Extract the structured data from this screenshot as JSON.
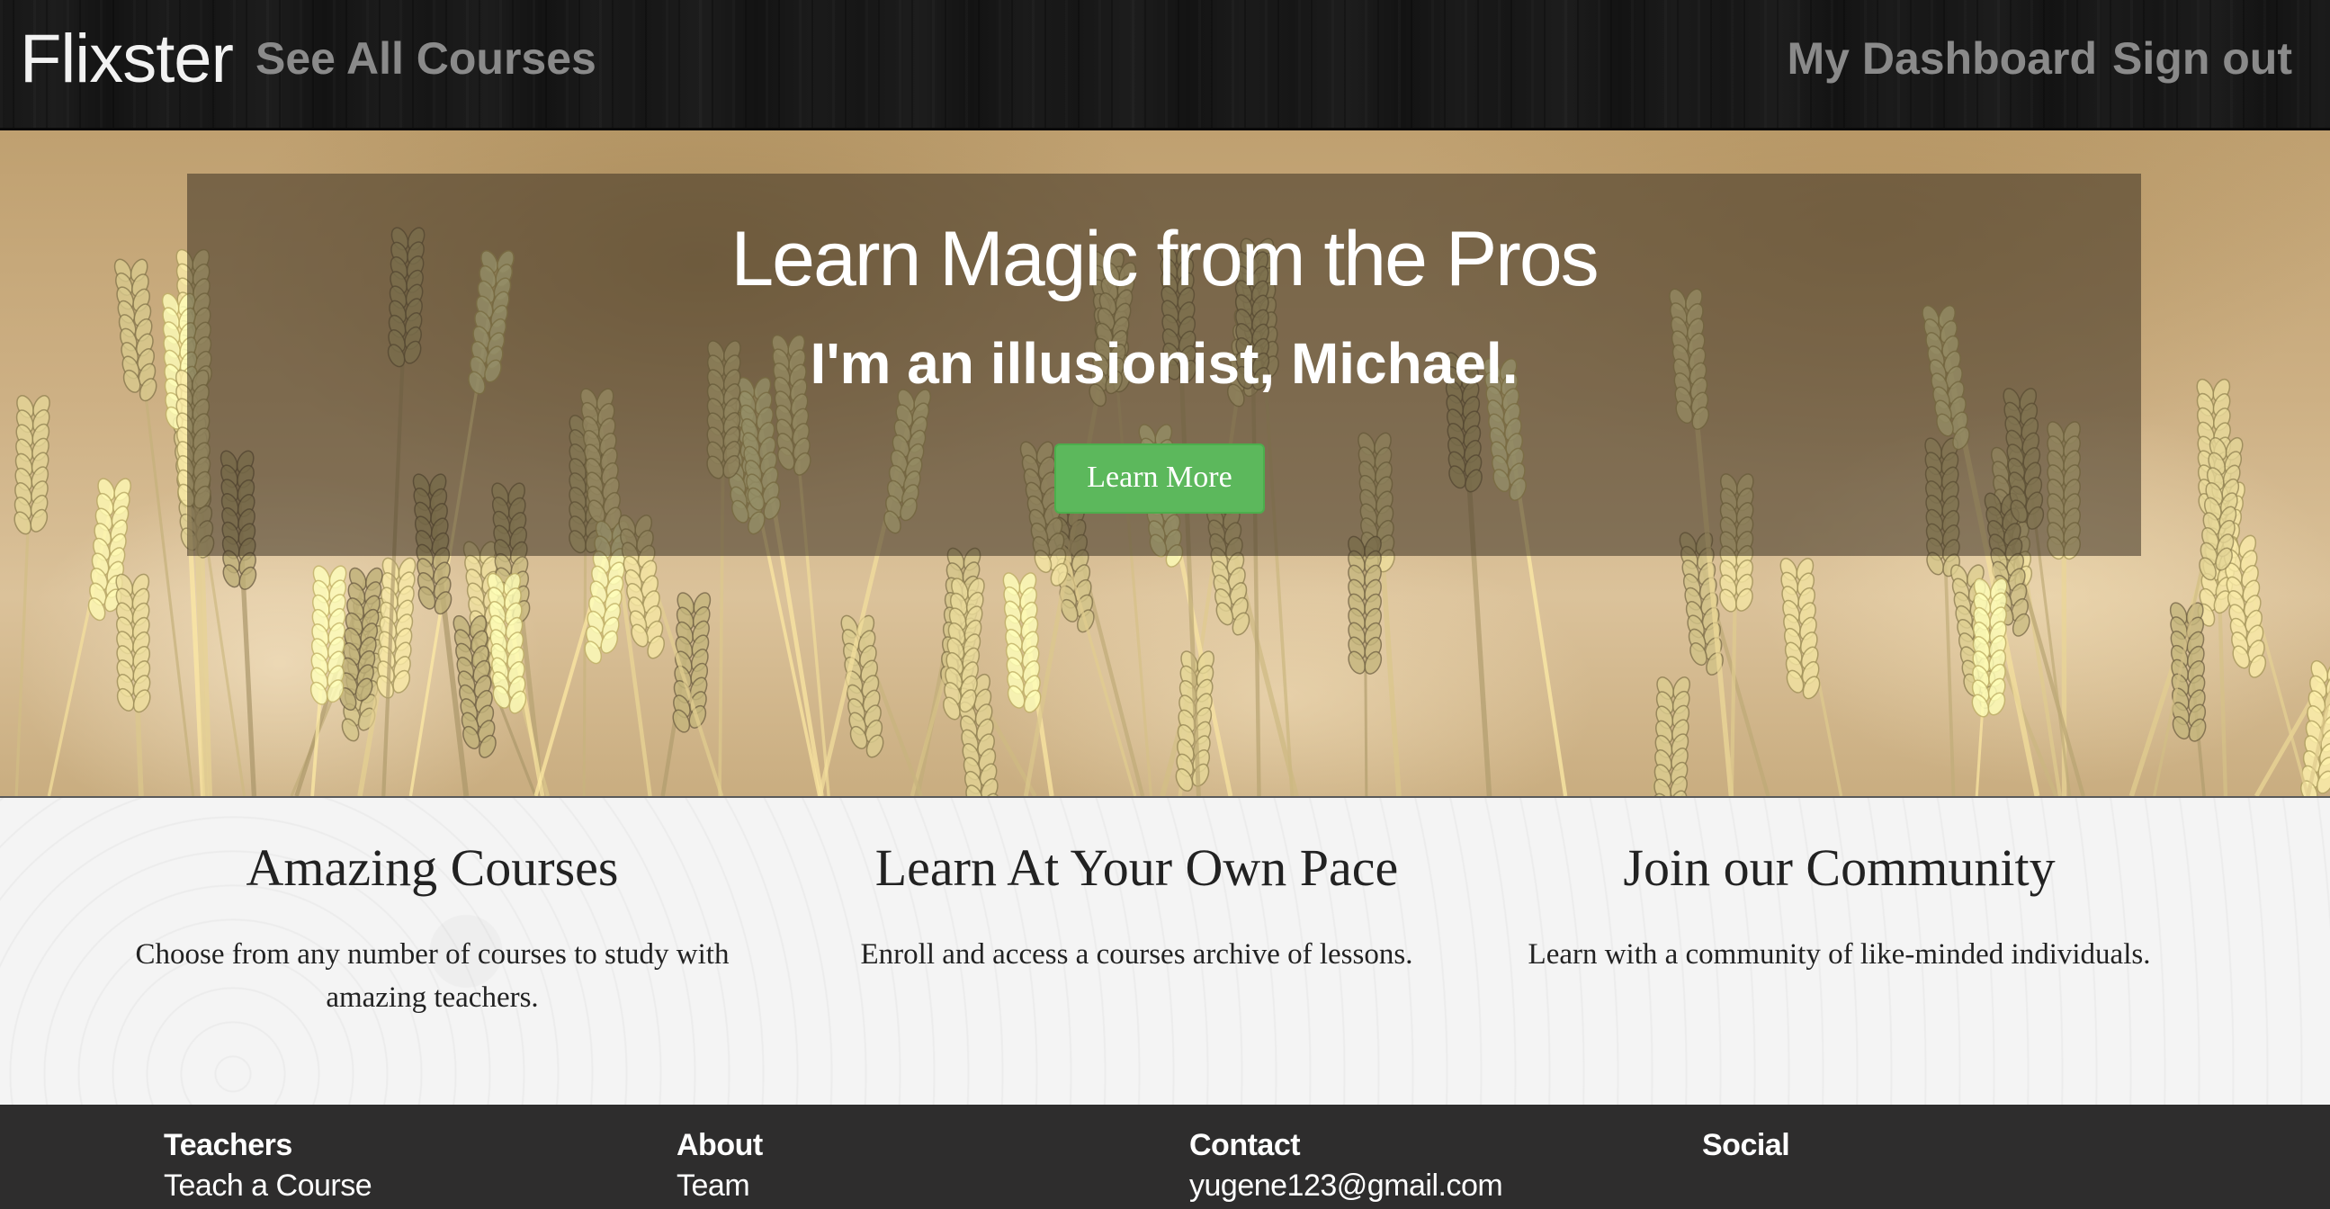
{
  "navbar": {
    "brand": "Flixster",
    "see_all_courses": "See All Courses",
    "my_dashboard": "My Dashboard",
    "sign_out": "Sign out"
  },
  "hero": {
    "title": "Learn Magic from the Pros",
    "subtitle": "I'm an illusionist, Michael.",
    "button_label": "Learn More",
    "button_color": "#5cb85c"
  },
  "features": [
    {
      "title": "Amazing Courses",
      "text": "Choose from any number of courses to study with amazing teachers."
    },
    {
      "title": "Learn At Your Own Pace",
      "text": "Enroll and access a courses archive of lessons."
    },
    {
      "title": "Join our Community",
      "text": "Learn with a community of like-minded individuals."
    }
  ],
  "footer": {
    "columns": [
      {
        "heading": "Teachers",
        "link": "Teach a Course"
      },
      {
        "heading": "About",
        "link": "Team"
      },
      {
        "heading": "Contact",
        "link": "yugene123@gmail.com"
      },
      {
        "heading": "Social",
        "link": ""
      }
    ]
  }
}
